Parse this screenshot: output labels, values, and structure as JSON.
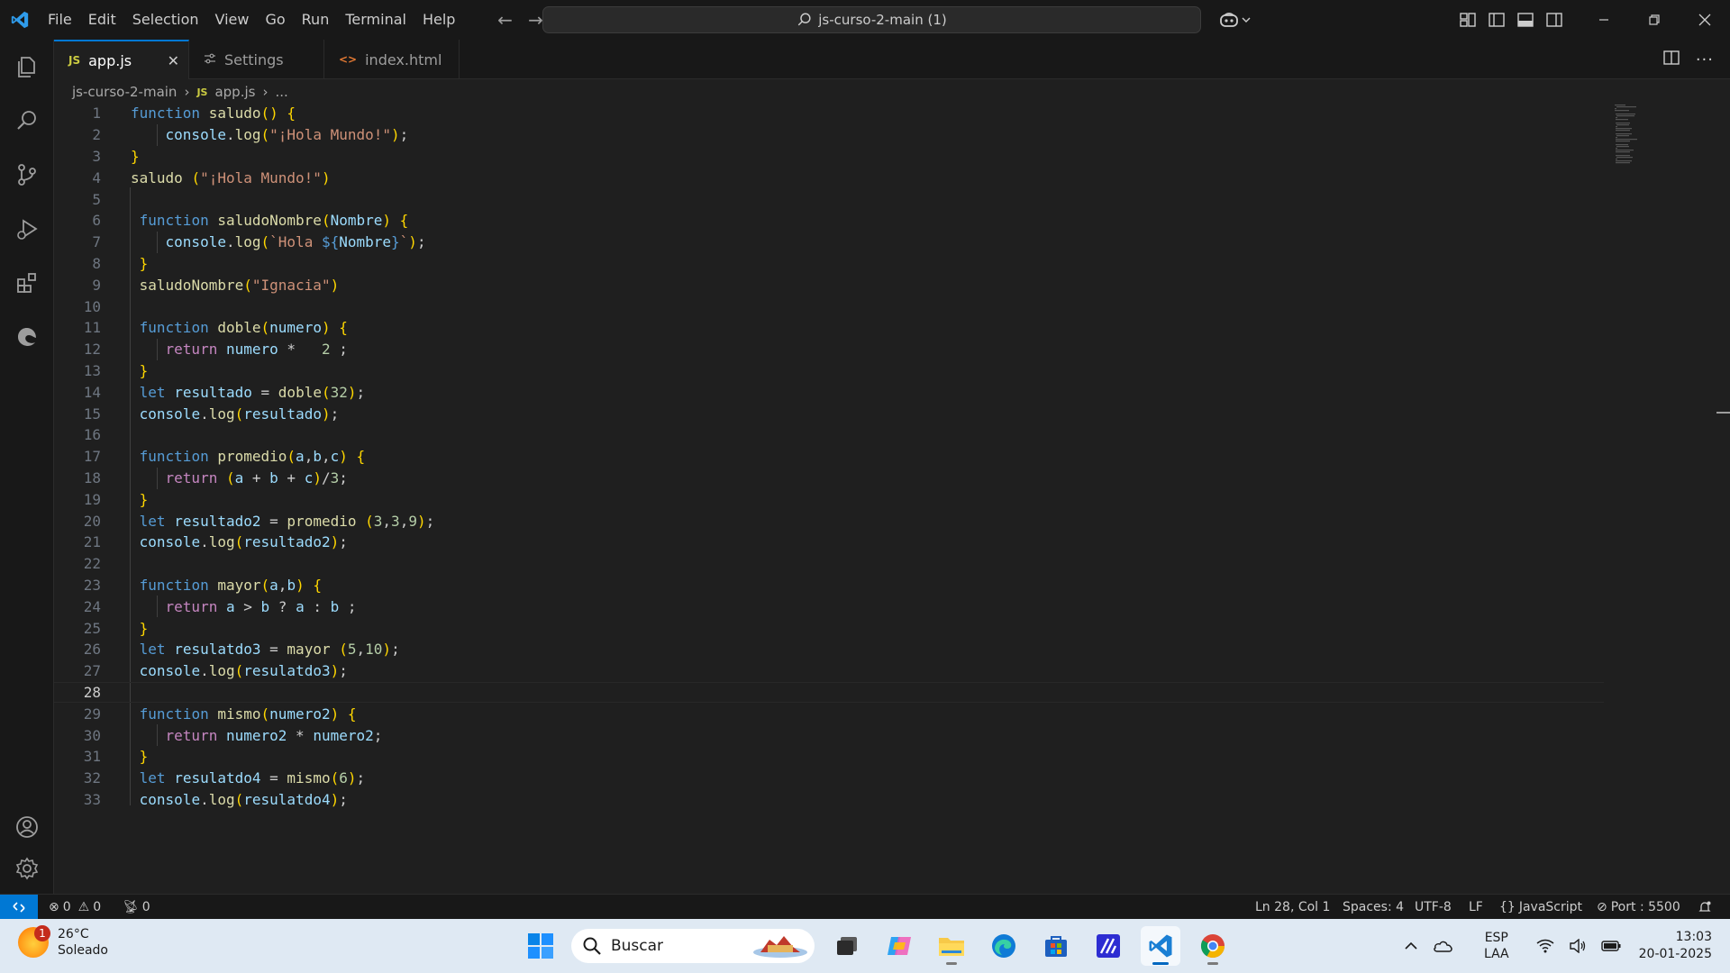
{
  "titlebar": {
    "menu": [
      "File",
      "Edit",
      "Selection",
      "View",
      "Go",
      "Run",
      "Terminal",
      "Help"
    ],
    "search_text": "js-curso-2-main (1)"
  },
  "tabs": [
    {
      "icon": "JS",
      "label": "app.js",
      "active": true
    },
    {
      "icon": "settings",
      "label": "Settings",
      "active": false
    },
    {
      "icon": "<>",
      "label": "index.html",
      "active": false
    }
  ],
  "breadcrumb": {
    "folder": "js-curso-2-main",
    "file_icon": "JS",
    "file": "app.js",
    "more": "..."
  },
  "editor": {
    "current_line": 28,
    "lines": [
      "function saludo() {",
      "    console.log(\"¡Hola Mundo!\");",
      "}",
      "saludo (\"¡Hola Mundo!\")",
      "",
      " function saludoNombre(Nombre) {",
      "    console.log(`Hola ${Nombre}`);",
      " }",
      " saludoNombre(\"Ignacia\")",
      "",
      " function doble(numero) {",
      "    return numero *   2 ;",
      " }",
      " let resultado = doble(32);",
      " console.log(resultado);",
      "",
      " function promedio(a,b,c) {",
      "    return (a + b + c)/3;",
      " }",
      " let resultado2 = promedio (3,3,9);",
      " console.log(resultado2);",
      "",
      " function mayor(a,b) {",
      "    return a > b ? a : b ;",
      " }",
      " let resulatdo3 = mayor (5,10);",
      " console.log(resulatdo3);",
      "",
      " function mismo(numero2) {",
      "    return numero2 * numero2;",
      " }",
      " let resulatdo4 = mismo(6);",
      " console.log(resulatdo4);"
    ]
  },
  "statusbar": {
    "errors": "0",
    "warnings": "0",
    "ports": "0",
    "position": "Ln 28, Col 1",
    "spaces": "Spaces: 4",
    "encoding": "UTF-8",
    "eol": "LF",
    "language": "JavaScript",
    "port": "Port : 5500"
  },
  "taskbar": {
    "weather_badge": "1",
    "temperature": "26°C",
    "condition": "Soleado",
    "search_label": "Buscar",
    "lang_top": "ESP",
    "lang_bottom": "LAA",
    "time": "13:03",
    "date": "20-01-2025"
  },
  "colors": {
    "accent": "#0078d4",
    "keyword": "#569cd6",
    "function": "#dcdcaa",
    "string": "#ce9178",
    "variable": "#9cdcfe",
    "number": "#b5cea8"
  }
}
